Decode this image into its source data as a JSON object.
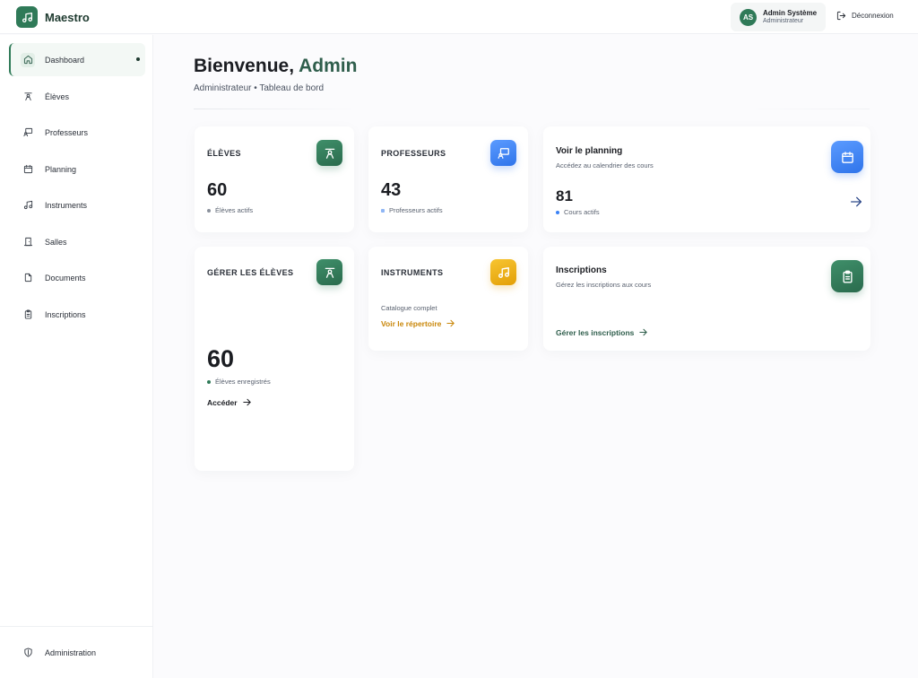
{
  "app": {
    "name": "Maestro"
  },
  "user": {
    "initials": "AS",
    "name": "Admin Système",
    "role": "Administrateur"
  },
  "header": {
    "logout_label": "Déconnexion"
  },
  "sidebar": {
    "items": [
      {
        "label": "Dashboard",
        "icon": "home-icon",
        "active": true
      },
      {
        "label": "Élèves",
        "icon": "student-icon"
      },
      {
        "label": "Professeurs",
        "icon": "teacher-icon"
      },
      {
        "label": "Planning",
        "icon": "calendar-icon"
      },
      {
        "label": "Instruments",
        "icon": "music-note-icon"
      },
      {
        "label": "Salles",
        "icon": "door-icon"
      },
      {
        "label": "Documents",
        "icon": "document-icon"
      },
      {
        "label": "Inscriptions",
        "icon": "clipboard-icon"
      }
    ],
    "footer": {
      "label": "Administration",
      "icon": "shield-icon"
    }
  },
  "main": {
    "welcome_prefix": "Bienvenue, ",
    "welcome_name": "Admin",
    "subtitle": "Administrateur • Tableau de bord",
    "cards": {
      "eleves": {
        "head": "ÉLÈVES",
        "value": "60",
        "meta": "Élèves actifs",
        "icon": "student-icon",
        "color": "#2f7a58"
      },
      "professeurs": {
        "head": "PROFESSEURS",
        "value": "43",
        "meta": "Professeurs actifs",
        "icon": "teacher-icon",
        "color": "#3b82f6"
      },
      "planning": {
        "title": "Voir le planning",
        "desc": "Accédez au calendrier des cours",
        "value": "81",
        "meta": "Cours actifs",
        "icon": "calendar-icon",
        "color": "#3b82f6"
      },
      "gerer_eleves": {
        "head": "GÉRER LES ÉLÈVES",
        "value": "60",
        "meta": "Élèves enregistrés",
        "link": "Accéder",
        "icon": "student-icon",
        "color": "#2f7a58"
      },
      "instruments": {
        "head": "INSTRUMENTS",
        "desc": "Catalogue complet",
        "link": "Voir le répertoire",
        "icon": "music-note-icon",
        "color": "#d99a06"
      },
      "inscriptions": {
        "title": "Inscriptions",
        "desc": "Gérez les inscriptions aux cours",
        "link": "Gérer les inscriptions",
        "icon": "clipboard-icon",
        "color": "#2f5e4c"
      }
    }
  }
}
